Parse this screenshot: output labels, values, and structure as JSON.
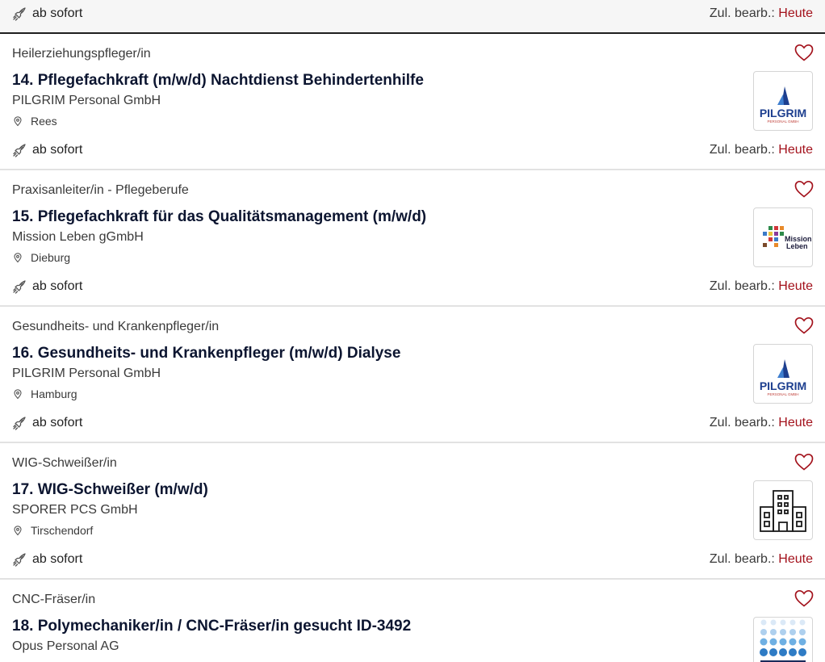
{
  "top_strip": {
    "start_label": "ab sofort",
    "edit_prefix": "Zul. bearb.:",
    "edit_value": "Heute"
  },
  "jobs": [
    {
      "occupation": "Heilerziehungspfleger/in",
      "title": "14. Pflegefachkraft (m/w/d) Nachtdienst Behindertenhilfe",
      "company": "PILGRIM Personal GmbH",
      "location": "Rees",
      "start_label": "ab sofort",
      "edit_prefix": "Zul. bearb.:",
      "edit_value": "Heute",
      "logo": "pilgrim-logo",
      "logo_text": "PILGRIM",
      "logo_subtext": "PERSONAL GMBH"
    },
    {
      "occupation": "Praxisanleiter/in - Pflegeberufe",
      "title": "15. Pflegefachkraft für das Qualitätsmanagement (m/w/d)",
      "company": "Mission Leben gGmbH",
      "location": "Dieburg",
      "start_label": "ab sofort",
      "edit_prefix": "Zul. bearb.:",
      "edit_value": "Heute",
      "logo": "mission-leben-logo",
      "logo_text_1": "Mission",
      "logo_text_2": "Leben"
    },
    {
      "occupation": "Gesundheits- und Krankenpfleger/in",
      "title": "16. Gesundheits- und Krankenpfleger (m/w/d) Dialyse",
      "company": "PILGRIM Personal GmbH",
      "location": "Hamburg",
      "start_label": "ab sofort",
      "edit_prefix": "Zul. bearb.:",
      "edit_value": "Heute",
      "logo": "pilgrim-logo",
      "logo_text": "PILGRIM",
      "logo_subtext": "PERSONAL GMBH"
    },
    {
      "occupation": "WIG-Schweißer/in",
      "title": "17. WIG-Schweißer (m/w/d)",
      "company": "SPORER PCS GmbH",
      "location": "Tirschendorf",
      "start_label": "ab sofort",
      "edit_prefix": "Zul. bearb.:",
      "edit_value": "Heute",
      "logo": "building-icon"
    },
    {
      "occupation": "CNC-Fräser/in",
      "title": "18. Polymechaniker/in / CNC-Fräser/in gesucht ID-3492",
      "company": "Opus Personal AG",
      "logo": "opus-logo"
    }
  ],
  "colors": {
    "accent_red": "#a3121c",
    "title_navy": "#0c1530",
    "pilgrim_blue": "#1d3f8f"
  },
  "icons": {
    "start": "rocket-icon",
    "location": "map-pin-icon",
    "favorite": "heart-outline-icon"
  }
}
